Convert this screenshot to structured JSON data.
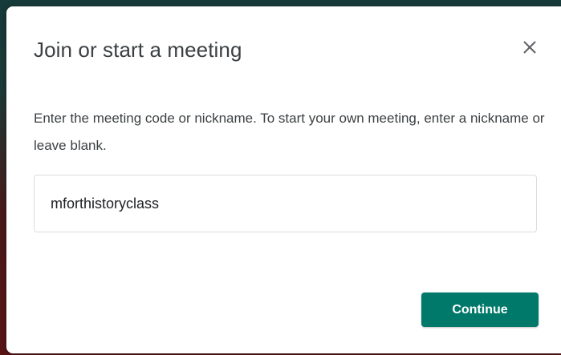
{
  "dialog": {
    "title": "Join or start a meeting",
    "description": "Enter the meeting code or nickname. To start your own meeting, enter a nickname or leave blank.",
    "input": {
      "value": "mforthistoryclass"
    },
    "continue_label": "Continue",
    "close_icon": "close-icon"
  },
  "colors": {
    "primary": "#00796b",
    "text": "#3c4043",
    "border": "#dadce0"
  }
}
